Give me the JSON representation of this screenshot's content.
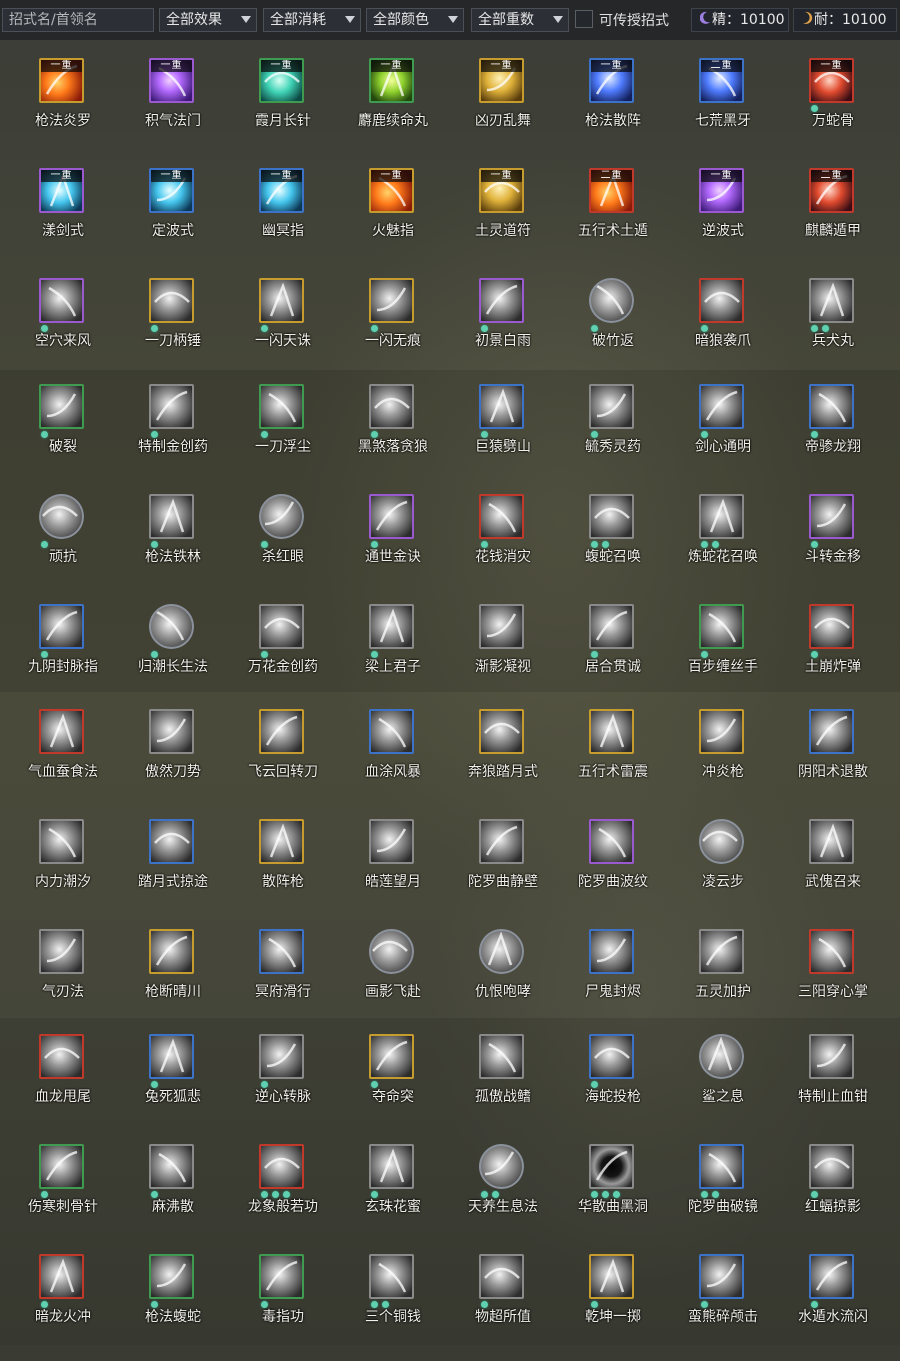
{
  "toolbar": {
    "search": {
      "placeholder": "招式名/首领名",
      "value": ""
    },
    "filters": [
      {
        "label": "全部效果"
      },
      {
        "label": "全部消耗"
      },
      {
        "label": "全部颜色"
      },
      {
        "label": "全部重数"
      }
    ],
    "transferable_label": "可传授招式",
    "transferable_checked": false,
    "essence": {
      "label": "精：10100",
      "icon": "moon-icon"
    },
    "stamina": {
      "label": "耐：10100",
      "icon": "crescent-icon"
    }
  },
  "colors": {
    "purple": "#9b59d0",
    "blue": "#3c72c8",
    "gold": "#c79c2e",
    "red": "#c0392b",
    "green": "#3e9b4f",
    "gray": "#8a8a8a",
    "dot": "#5fd0b0"
  },
  "skills": [
    {
      "name": "枪法炎罗",
      "tier": "一重",
      "frame": "gold",
      "style": "fire",
      "dots": 0
    },
    {
      "name": "积气法门",
      "tier": "一重",
      "frame": "purple",
      "style": "violet",
      "dots": 0
    },
    {
      "name": "霞月长针",
      "tier": "一重",
      "frame": "green",
      "style": "teal",
      "dots": 0
    },
    {
      "name": "麝鹿续命丸",
      "tier": "一重",
      "frame": "green",
      "style": "lime",
      "dots": 0
    },
    {
      "name": "凶刃乱舞",
      "tier": "一重",
      "frame": "gold",
      "style": "gold",
      "dots": 0
    },
    {
      "name": "枪法散阵",
      "tier": "一重",
      "frame": "blue",
      "style": "blue",
      "dots": 0
    },
    {
      "name": "七荒黑牙",
      "tier": "二重",
      "frame": "blue",
      "style": "blue",
      "dots": 0
    },
    {
      "name": "万蛇骨",
      "tier": "一重",
      "frame": "red",
      "style": "crimson",
      "dots": 1
    },
    {
      "name": "漾剑式",
      "tier": "一重",
      "frame": "purple",
      "style": "cyan",
      "dots": 0
    },
    {
      "name": "定波式",
      "tier": "一重",
      "frame": "blue",
      "style": "cyan",
      "dots": 0
    },
    {
      "name": "幽冥指",
      "tier": "一重",
      "frame": "blue",
      "style": "cyan",
      "dots": 0
    },
    {
      "name": "火魅指",
      "tier": "一重",
      "frame": "gold",
      "style": "fire",
      "dots": 0
    },
    {
      "name": "土灵道符",
      "tier": "一重",
      "frame": "gold",
      "style": "gold",
      "dots": 0
    },
    {
      "name": "五行术土遁",
      "tier": "二重",
      "frame": "red",
      "style": "fire",
      "dots": 0
    },
    {
      "name": "逆波式",
      "tier": "一重",
      "frame": "purple",
      "style": "violet",
      "dots": 0
    },
    {
      "name": "麒麟遁甲",
      "tier": "二重",
      "frame": "red",
      "style": "crimson",
      "dots": 0
    },
    {
      "name": "空穴来风",
      "tier": "",
      "frame": "purple",
      "style": "gray",
      "dots": 1
    },
    {
      "name": "一刀柄锤",
      "tier": "",
      "frame": "gold",
      "style": "gray",
      "dots": 1
    },
    {
      "name": "一闪天诛",
      "tier": "",
      "frame": "gold",
      "style": "gray",
      "dots": 1
    },
    {
      "name": "一闪无痕",
      "tier": "",
      "frame": "gold",
      "style": "gray",
      "dots": 1
    },
    {
      "name": "初景白雨",
      "tier": "",
      "frame": "purple",
      "style": "gray",
      "dots": 1
    },
    {
      "name": "破竹返",
      "tier": "",
      "frame": "round",
      "style": "gray",
      "dots": 1
    },
    {
      "name": "暗狼袭爪",
      "tier": "",
      "frame": "red",
      "style": "gray",
      "dots": 1
    },
    {
      "name": "兵犬丸",
      "tier": "",
      "frame": "gray",
      "style": "gray",
      "dots": 2
    },
    {
      "name": "破裂",
      "tier": "",
      "frame": "green",
      "style": "gray",
      "dots": 1
    },
    {
      "name": "特制金创药",
      "tier": "",
      "frame": "gray",
      "style": "gray",
      "dots": 1
    },
    {
      "name": "一刀浮尘",
      "tier": "",
      "frame": "green",
      "style": "gray",
      "dots": 1
    },
    {
      "name": "黑煞落贪狼",
      "tier": "",
      "frame": "gray",
      "style": "gray",
      "dots": 1
    },
    {
      "name": "巨猿劈山",
      "tier": "",
      "frame": "blue",
      "style": "gray",
      "dots": 1
    },
    {
      "name": "毓秀灵药",
      "tier": "",
      "frame": "gray",
      "style": "gray",
      "dots": 1
    },
    {
      "name": "剑心通明",
      "tier": "",
      "frame": "blue",
      "style": "gray",
      "dots": 1
    },
    {
      "name": "帝骖龙翔",
      "tier": "",
      "frame": "blue",
      "style": "gray",
      "dots": 1
    },
    {
      "name": "顽抗",
      "tier": "",
      "frame": "round",
      "style": "gray",
      "dots": 1
    },
    {
      "name": "枪法铁林",
      "tier": "",
      "frame": "gray",
      "style": "gray",
      "dots": 1
    },
    {
      "name": "杀红眼",
      "tier": "",
      "frame": "round",
      "style": "gray",
      "dots": 1
    },
    {
      "name": "通世金诀",
      "tier": "",
      "frame": "purple",
      "style": "gray",
      "dots": 1
    },
    {
      "name": "花钱消灾",
      "tier": "",
      "frame": "red",
      "style": "gray",
      "dots": 1
    },
    {
      "name": "蝮蛇召唤",
      "tier": "",
      "frame": "gray",
      "style": "gray",
      "dots": 2
    },
    {
      "name": "炼蛇花召唤",
      "tier": "",
      "frame": "gray",
      "style": "gray",
      "dots": 2
    },
    {
      "name": "斗转金移",
      "tier": "",
      "frame": "purple",
      "style": "gray",
      "dots": 1
    },
    {
      "name": "九阴封脉指",
      "tier": "",
      "frame": "blue",
      "style": "gray",
      "dots": 1
    },
    {
      "name": "归潮长生法",
      "tier": "",
      "frame": "round",
      "style": "gray",
      "dots": 1
    },
    {
      "name": "万花金创药",
      "tier": "",
      "frame": "gray",
      "style": "gray",
      "dots": 1
    },
    {
      "name": "梁上君子",
      "tier": "",
      "frame": "gray",
      "style": "gray",
      "dots": 1
    },
    {
      "name": "渐影凝视",
      "tier": "",
      "frame": "gray",
      "style": "gray",
      "dots": 0
    },
    {
      "name": "居合贯诚",
      "tier": "",
      "frame": "gray",
      "style": "gray",
      "dots": 1
    },
    {
      "name": "百步缠丝手",
      "tier": "",
      "frame": "green",
      "style": "gray",
      "dots": 1
    },
    {
      "name": "土崩炸弹",
      "tier": "",
      "frame": "red",
      "style": "gray",
      "dots": 1
    },
    {
      "name": "气血蚕食法",
      "tier": "",
      "frame": "red",
      "style": "gray",
      "dots": 0
    },
    {
      "name": "傲然刀势",
      "tier": "",
      "frame": "gray",
      "style": "gray",
      "dots": 0
    },
    {
      "name": "飞云回转刀",
      "tier": "",
      "frame": "gold",
      "style": "gray",
      "dots": 0
    },
    {
      "name": "血涂风暴",
      "tier": "",
      "frame": "blue",
      "style": "gray",
      "dots": 0
    },
    {
      "name": "奔狼踏月式",
      "tier": "",
      "frame": "gold",
      "style": "gray",
      "dots": 0
    },
    {
      "name": "五行术雷震",
      "tier": "",
      "frame": "gold",
      "style": "gray",
      "dots": 0
    },
    {
      "name": "冲炎枪",
      "tier": "",
      "frame": "gold",
      "style": "gray",
      "dots": 0
    },
    {
      "name": "阴阳术退散",
      "tier": "",
      "frame": "blue",
      "style": "gray",
      "dots": 0
    },
    {
      "name": "内力潮汐",
      "tier": "",
      "frame": "gray",
      "style": "gray",
      "dots": 0
    },
    {
      "name": "踏月式掠途",
      "tier": "",
      "frame": "blue",
      "style": "gray",
      "dots": 0
    },
    {
      "name": "散阵枪",
      "tier": "",
      "frame": "gold",
      "style": "gray",
      "dots": 0
    },
    {
      "name": "皓莲望月",
      "tier": "",
      "frame": "gray",
      "style": "gray",
      "dots": 0
    },
    {
      "name": "陀罗曲静壁",
      "tier": "",
      "frame": "gray",
      "style": "gray",
      "dots": 0
    },
    {
      "name": "陀罗曲波纹",
      "tier": "",
      "frame": "purple",
      "style": "gray",
      "dots": 0
    },
    {
      "name": "凌云步",
      "tier": "",
      "frame": "round",
      "style": "gray",
      "dots": 0
    },
    {
      "name": "武傀召来",
      "tier": "",
      "frame": "gray",
      "style": "gray",
      "dots": 0
    },
    {
      "name": "气刃法",
      "tier": "",
      "frame": "gray",
      "style": "gray",
      "dots": 0
    },
    {
      "name": "枪断晴川",
      "tier": "",
      "frame": "gold",
      "style": "gray",
      "dots": 0
    },
    {
      "name": "冥府滑行",
      "tier": "",
      "frame": "blue",
      "style": "gray",
      "dots": 0
    },
    {
      "name": "画影飞赴",
      "tier": "",
      "frame": "round",
      "style": "gray",
      "dots": 0
    },
    {
      "name": "仇恨咆哮",
      "tier": "",
      "frame": "round",
      "style": "gray",
      "dots": 0
    },
    {
      "name": "尸鬼封烬",
      "tier": "",
      "frame": "blue",
      "style": "gray",
      "dots": 0
    },
    {
      "name": "五灵加护",
      "tier": "",
      "frame": "gray",
      "style": "gray",
      "dots": 0
    },
    {
      "name": "三阳穿心掌",
      "tier": "",
      "frame": "red",
      "style": "gray",
      "dots": 0
    },
    {
      "name": "血龙甩尾",
      "tier": "",
      "frame": "red",
      "style": "gray",
      "dots": 0
    },
    {
      "name": "兔死狐悲",
      "tier": "",
      "frame": "blue",
      "style": "gray",
      "dots": 1
    },
    {
      "name": "逆心转脉",
      "tier": "",
      "frame": "gray",
      "style": "gray",
      "dots": 1
    },
    {
      "name": "夺命突",
      "tier": "",
      "frame": "gold",
      "style": "gray",
      "dots": 1
    },
    {
      "name": "孤傲战鳍",
      "tier": "",
      "frame": "gray",
      "style": "gray",
      "dots": 0
    },
    {
      "name": "海蛇投枪",
      "tier": "",
      "frame": "blue",
      "style": "gray",
      "dots": 1
    },
    {
      "name": "鲨之息",
      "tier": "",
      "frame": "round",
      "style": "gray",
      "dots": 0
    },
    {
      "name": "特制止血钳",
      "tier": "",
      "frame": "gray",
      "style": "gray",
      "dots": 0
    },
    {
      "name": "伤寒刺骨针",
      "tier": "",
      "frame": "green",
      "style": "gray",
      "dots": 1
    },
    {
      "name": "麻沸散",
      "tier": "",
      "frame": "gray",
      "style": "gray",
      "dots": 1
    },
    {
      "name": "龙象般若功",
      "tier": "",
      "frame": "red",
      "style": "gray",
      "dots": 3
    },
    {
      "name": "玄珠花蜜",
      "tier": "",
      "frame": "gray",
      "style": "gray",
      "dots": 1
    },
    {
      "name": "天养生息法",
      "tier": "",
      "frame": "round",
      "style": "gray",
      "dots": 2
    },
    {
      "name": "华散曲黑洞",
      "tier": "",
      "frame": "gray",
      "style": "dark",
      "dots": 3
    },
    {
      "name": "陀罗曲破镜",
      "tier": "",
      "frame": "blue",
      "style": "gray",
      "dots": 2
    },
    {
      "name": "红蝠掠影",
      "tier": "",
      "frame": "gray",
      "style": "gray",
      "dots": 1
    },
    {
      "name": "暗龙火冲",
      "tier": "",
      "frame": "red",
      "style": "gray",
      "dots": 1
    },
    {
      "name": "枪法蝮蛇",
      "tier": "",
      "frame": "green",
      "style": "gray",
      "dots": 1
    },
    {
      "name": "毒指功",
      "tier": "",
      "frame": "green",
      "style": "gray",
      "dots": 1
    },
    {
      "name": "三个铜钱",
      "tier": "",
      "frame": "gray",
      "style": "gray",
      "dots": 2
    },
    {
      "name": "物超所值",
      "tier": "",
      "frame": "gray",
      "style": "gray",
      "dots": 1
    },
    {
      "name": "乾坤一掷",
      "tier": "",
      "frame": "gold",
      "style": "gray",
      "dots": 1
    },
    {
      "name": "蛮熊碎颅击",
      "tier": "",
      "frame": "blue",
      "style": "gray",
      "dots": 1
    },
    {
      "name": "水遁水流闪",
      "tier": "",
      "frame": "blue",
      "style": "gray",
      "dots": 1
    }
  ]
}
